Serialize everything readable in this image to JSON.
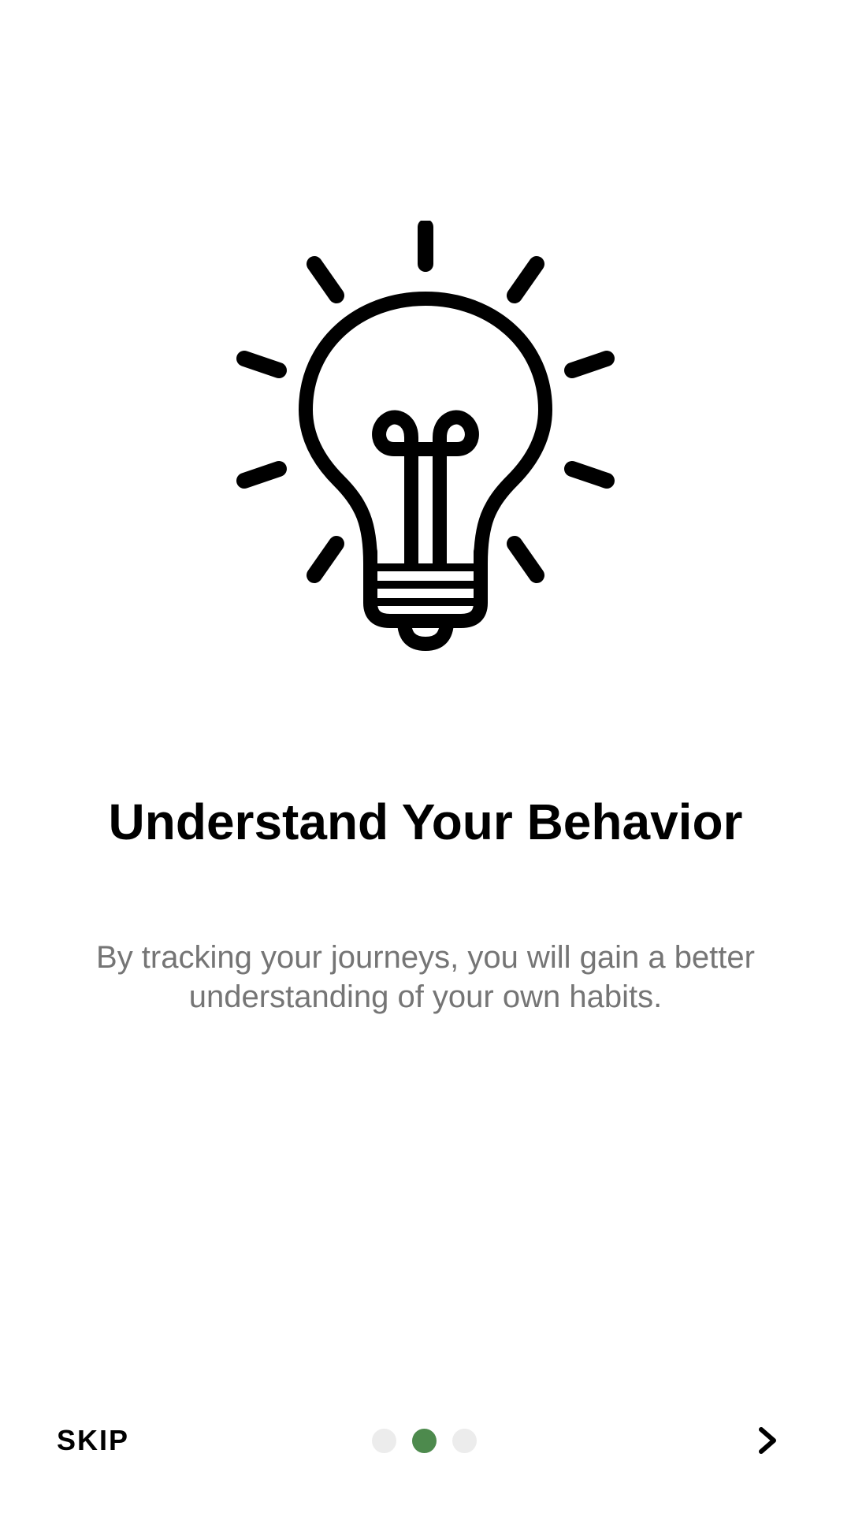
{
  "onboarding": {
    "illustration_icon": "lightbulb-icon",
    "title": "Understand Your Behavior",
    "description": "By tracking your journeys, you will gain a better understanding of your own habits."
  },
  "navigation": {
    "skip_label": "SKIP",
    "next_icon": "chevron-right-icon",
    "page_count": 3,
    "current_page": 2
  },
  "colors": {
    "background": "#ffffff",
    "title": "#000000",
    "description": "#757575",
    "dot_inactive": "#ececec",
    "dot_active": "#4d8a4d"
  }
}
